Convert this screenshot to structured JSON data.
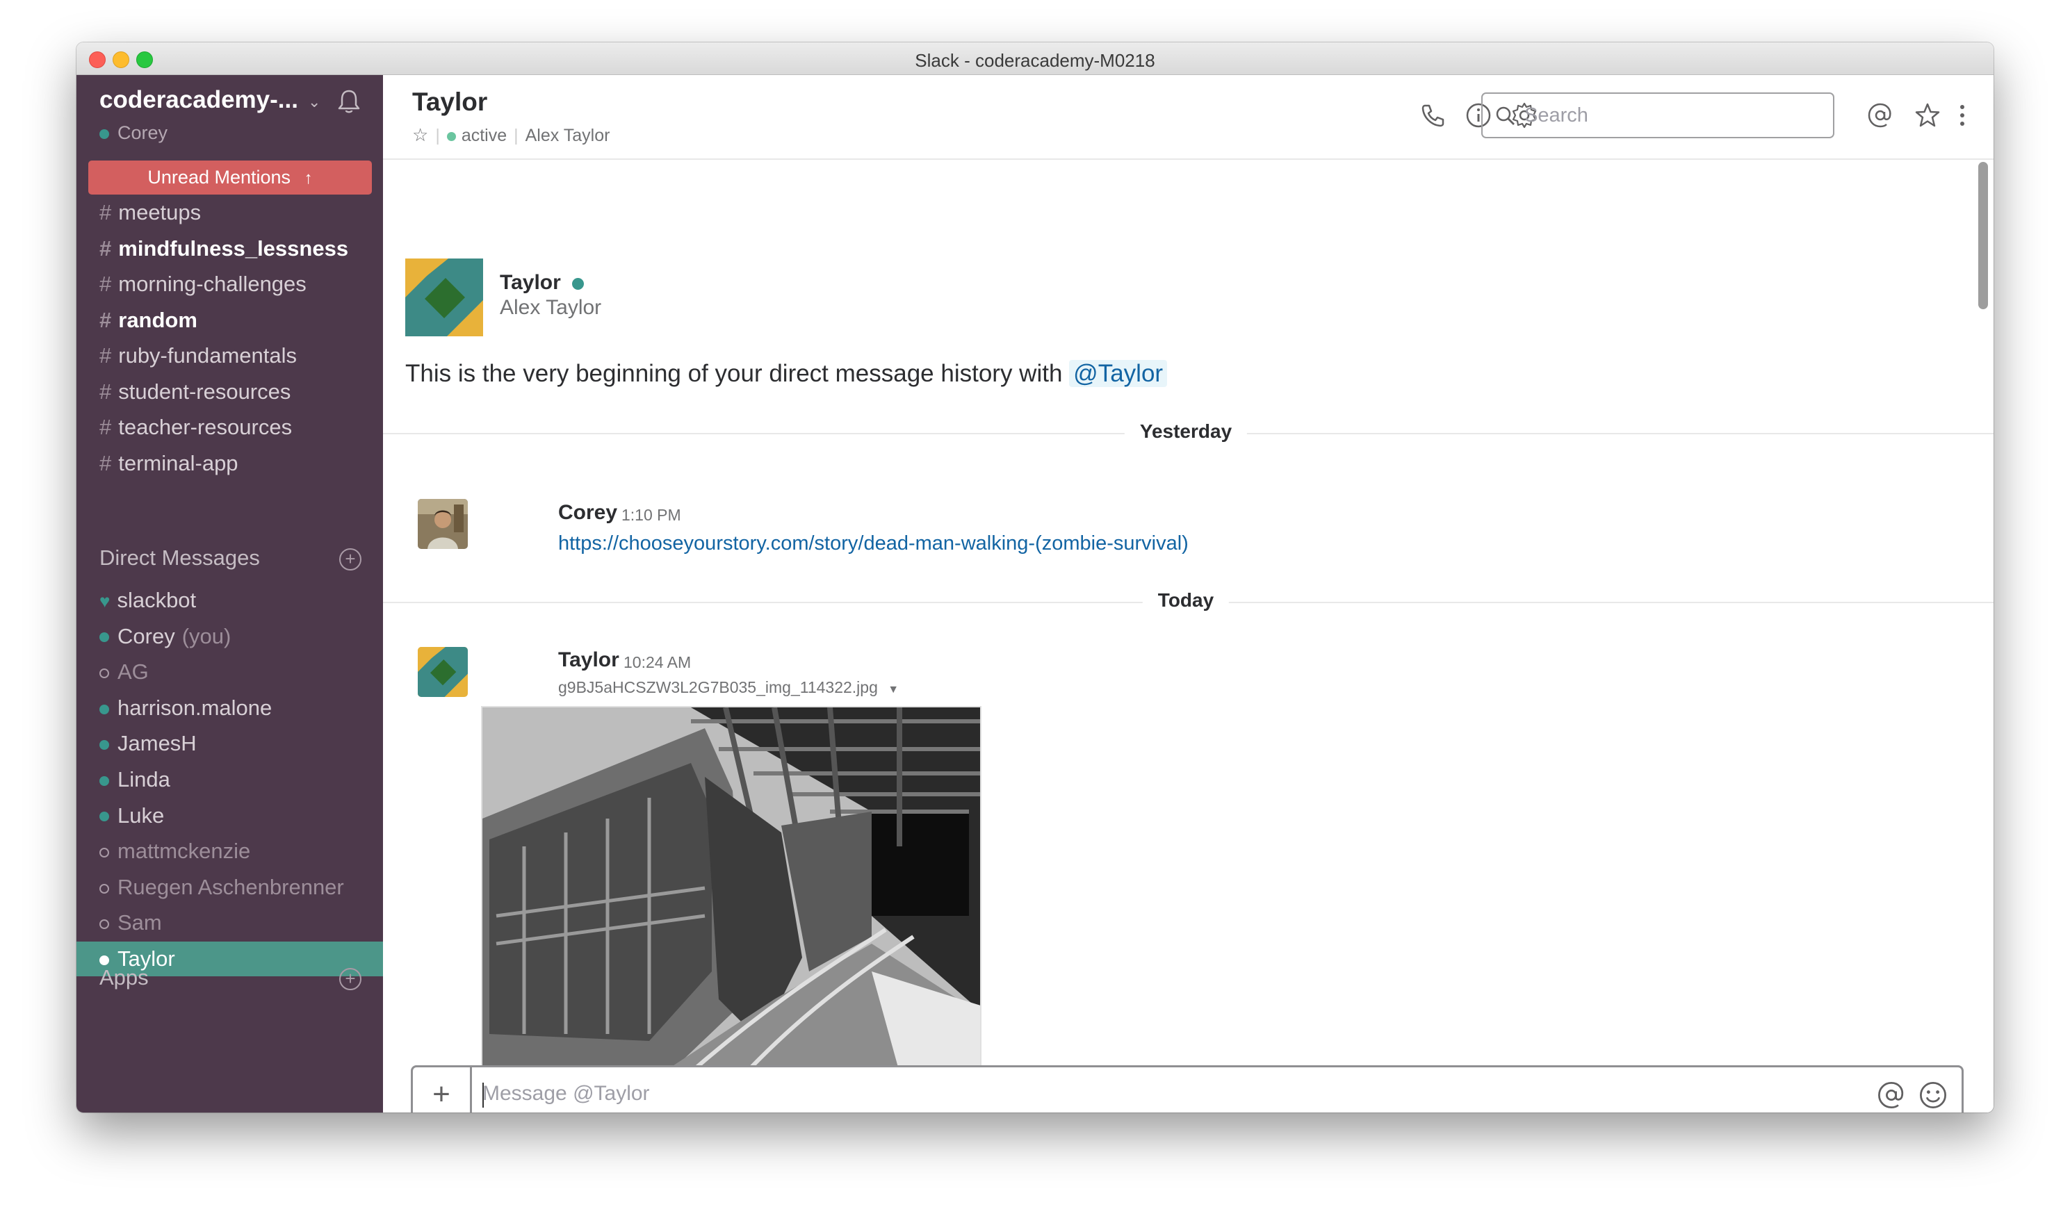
{
  "window": {
    "title": "Slack - coderacademy-M0218"
  },
  "sidebar": {
    "team_name": "coderacademy-...",
    "current_user": "Corey",
    "unread_mentions": "Unread Mentions",
    "channels": [
      {
        "name": "meetups",
        "bold": false
      },
      {
        "name": "mindfulness_lessness",
        "bold": true
      },
      {
        "name": "morning-challenges",
        "bold": false
      },
      {
        "name": "random",
        "bold": true
      },
      {
        "name": "ruby-fundamentals",
        "bold": false
      },
      {
        "name": "student-resources",
        "bold": false
      },
      {
        "name": "teacher-resources",
        "bold": false
      },
      {
        "name": "terminal-app",
        "bold": false
      }
    ],
    "direct_messages_label": "Direct Messages",
    "direct_messages": [
      {
        "name": "slackbot",
        "status": "bot"
      },
      {
        "name": "Corey",
        "suffix": "(you)",
        "status": "online"
      },
      {
        "name": "AG",
        "status": "away"
      },
      {
        "name": "harrison.malone",
        "status": "online"
      },
      {
        "name": "JamesH",
        "status": "online"
      },
      {
        "name": "Linda",
        "status": "online"
      },
      {
        "name": "Luke",
        "status": "online"
      },
      {
        "name": "mattmckenzie",
        "status": "away"
      },
      {
        "name": "Ruegen Aschenbrenner",
        "status": "away"
      },
      {
        "name": "Sam",
        "status": "away"
      },
      {
        "name": "Taylor",
        "status": "online",
        "active": true
      }
    ],
    "apps_label": "Apps"
  },
  "header": {
    "title": "Taylor",
    "status": "active",
    "full_name": "Alex Taylor",
    "search_placeholder": "Search"
  },
  "intro": {
    "name": "Taylor",
    "full_name": "Alex Taylor",
    "text": "This is the very beginning of your direct message history with",
    "mention": "@Taylor"
  },
  "messages": {
    "divider_yesterday": "Yesterday",
    "divider_today": "Today",
    "yesterday": {
      "sender": "Corey",
      "time": "1:10 PM",
      "link": "https://chooseyourstory.com/story/dead-man-walking-(zombie-survival)"
    },
    "today": {
      "sender": "Taylor",
      "time": "10:24 AM",
      "file_name": "g9BJ5aHCSZW3L2G7B035_img_114322.jpg"
    }
  },
  "composer": {
    "placeholder": "Message @Taylor"
  },
  "colors": {
    "sidebar_bg": "#4d394b",
    "active_item": "#4c9689",
    "unread_banner": "#d35f5f",
    "link": "#1264a3",
    "presence_online": "#38978d"
  }
}
